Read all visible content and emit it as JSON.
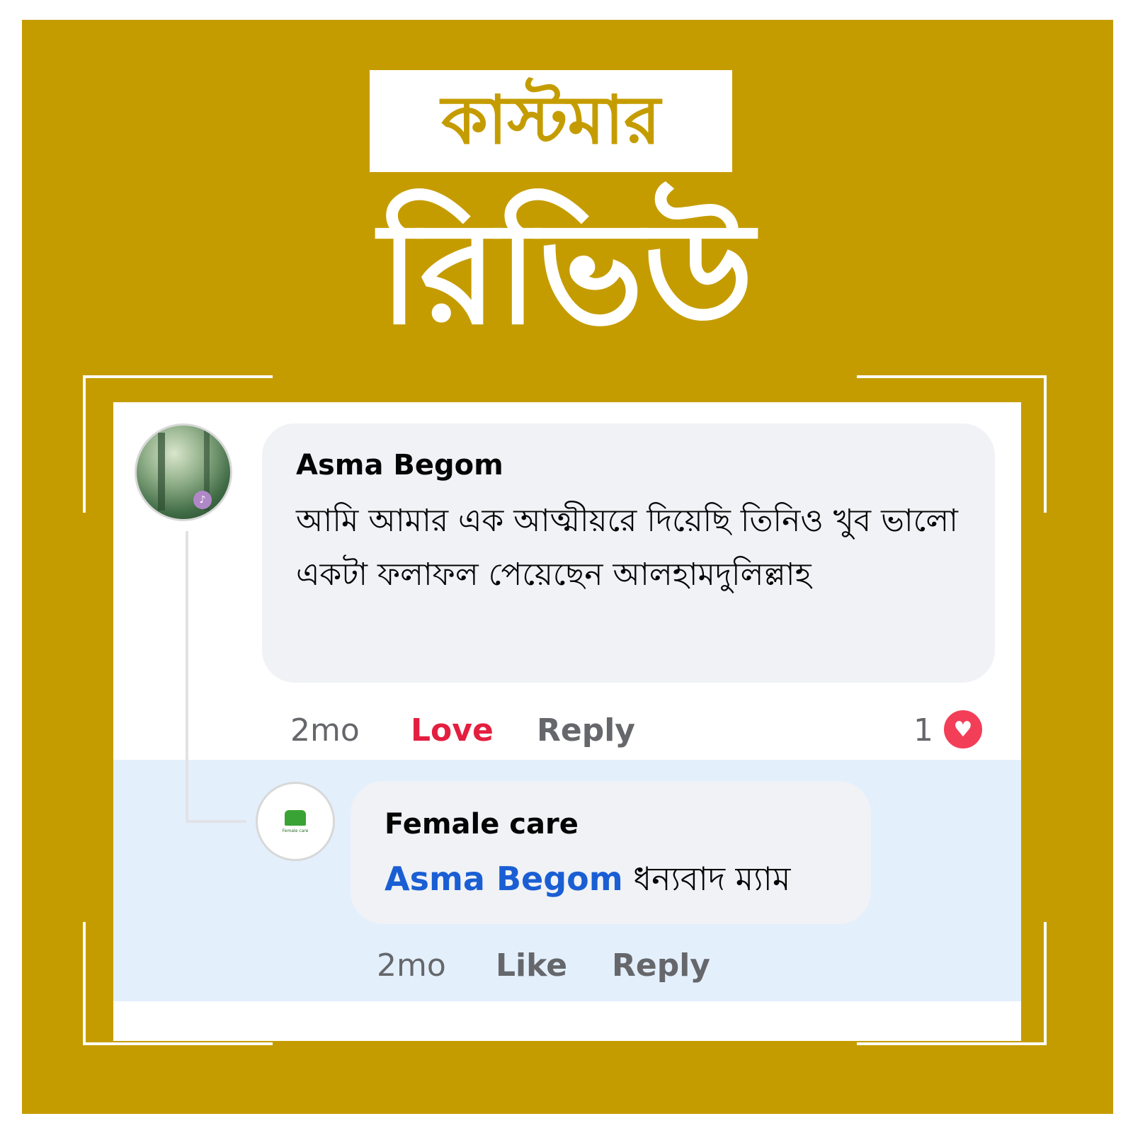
{
  "header": {
    "title_small": "কাস্টমার",
    "title_large": "রিভিউ"
  },
  "comment": {
    "author": "Asma Begom",
    "text": "আমি আমার এক আত্মীয়রে দিয়েছি তিনিও খুব ভালো একটা ফলাফল পেয়েছেন আলহামদুলিল্লাহ",
    "time": "2mo",
    "love_label": "Love",
    "reply_label": "Reply",
    "reaction_count": "1",
    "reaction_icon": "heart-icon"
  },
  "reply": {
    "author": "Female care",
    "mention": "Asma Begom",
    "text": "ধন্যবাদ ম্যাম",
    "time": "2mo",
    "like_label": "Like",
    "reply_label": "Reply",
    "avatar_logo_text": "Female care"
  },
  "colors": {
    "frame": "#c59c00",
    "love": "#e41e3f",
    "mention": "#1a5ed4",
    "reply_highlight": "#e4effc",
    "bubble": "#f0f2f5"
  }
}
